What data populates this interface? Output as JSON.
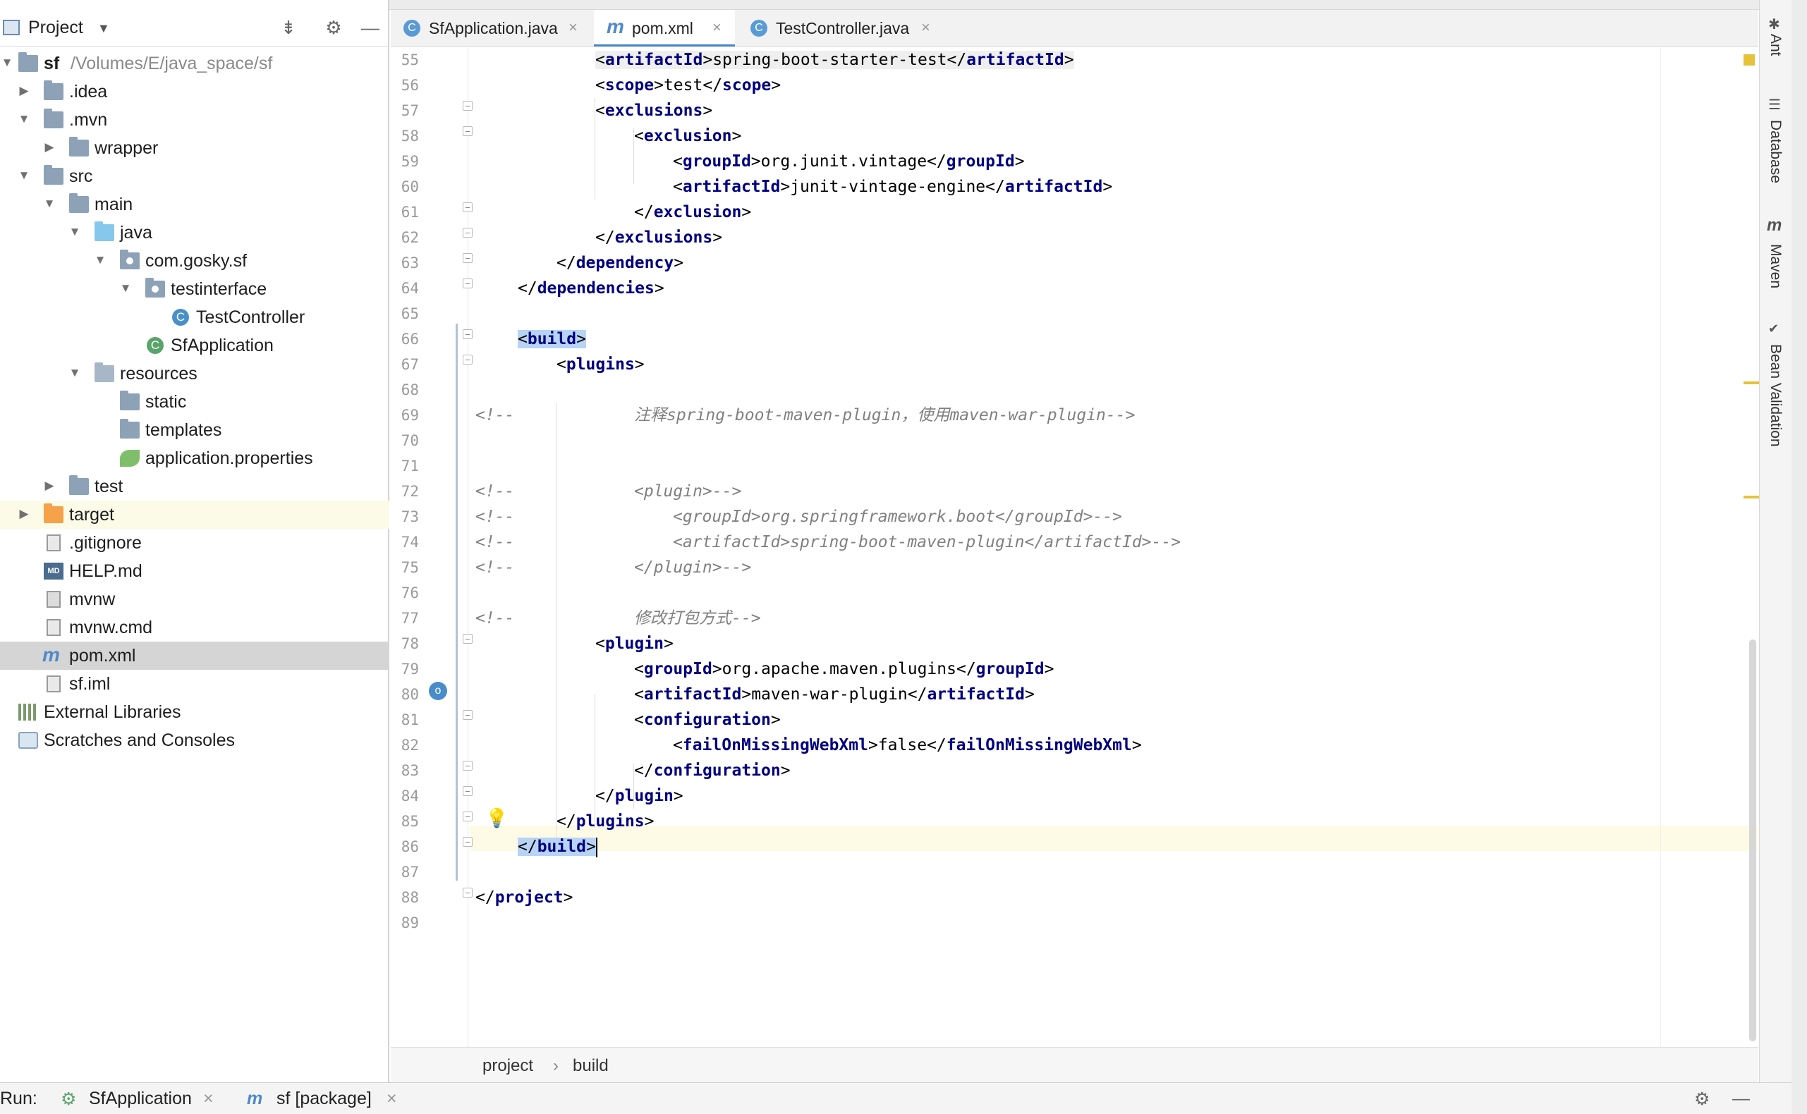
{
  "project_panel": {
    "title": "Project",
    "tree": [
      {
        "label": "sf",
        "path": "/Volumes/E/java_space/sf",
        "icon": "module-folder-icon"
      },
      {
        "label": ".idea",
        "icon": "folder-icon"
      },
      {
        "label": ".mvn",
        "icon": "folder-icon"
      },
      {
        "label": "wrapper",
        "icon": "folder-icon"
      },
      {
        "label": "src",
        "icon": "folder-icon"
      },
      {
        "label": "main",
        "icon": "folder-icon"
      },
      {
        "label": "java",
        "icon": "source-folder-icon"
      },
      {
        "label": "com.gosky.sf",
        "icon": "package-icon"
      },
      {
        "label": "testinterface",
        "icon": "package-icon"
      },
      {
        "label": "TestController",
        "icon": "class-icon"
      },
      {
        "label": "SfApplication",
        "icon": "spring-class-icon"
      },
      {
        "label": "resources",
        "icon": "resources-folder-icon"
      },
      {
        "label": "static",
        "icon": "folder-icon"
      },
      {
        "label": "templates",
        "icon": "folder-icon"
      },
      {
        "label": "application.properties",
        "icon": "spring-properties-icon"
      },
      {
        "label": "test",
        "icon": "folder-icon"
      },
      {
        "label": "target",
        "icon": "excluded-folder-icon"
      },
      {
        "label": ".gitignore",
        "icon": "file-icon"
      },
      {
        "label": "HELP.md",
        "icon": "markdown-icon"
      },
      {
        "label": "mvnw",
        "icon": "script-icon"
      },
      {
        "label": "mvnw.cmd",
        "icon": "file-icon"
      },
      {
        "label": "pom.xml",
        "icon": "maven-icon"
      },
      {
        "label": "sf.iml",
        "icon": "file-icon"
      },
      {
        "label": "External Libraries",
        "icon": "library-icon"
      },
      {
        "label": "Scratches and Consoles",
        "icon": "scratch-icon"
      }
    ]
  },
  "tabs": [
    {
      "label": "SfApplication.java",
      "icon": "class-icon"
    },
    {
      "label": "pom.xml",
      "icon": "maven-icon"
    },
    {
      "label": "TestController.java",
      "icon": "class-icon"
    }
  ],
  "editor": {
    "line_numbers": [
      "55",
      "56",
      "57",
      "58",
      "59",
      "60",
      "61",
      "62",
      "63",
      "64",
      "65",
      "66",
      "67",
      "68",
      "69",
      "70",
      "71",
      "72",
      "73",
      "74",
      "75",
      "76",
      "77",
      "78",
      "79",
      "80",
      "81",
      "82",
      "83",
      "84",
      "85",
      "86",
      "87",
      "88",
      "89"
    ],
    "code": {
      "l55": {
        "open": "<",
        "tag": "artifactId",
        "mid": ">spring-boot-starter-test</",
        "tag2": "artifactId",
        "close": ">"
      },
      "l56": {
        "open": "<",
        "tag": "scope",
        "mid": ">test</",
        "tag2": "scope",
        "close": ">"
      },
      "l57": {
        "open": "<",
        "tag": "exclusions",
        "close": ">"
      },
      "l58": {
        "open": "<",
        "tag": "exclusion",
        "close": ">"
      },
      "l59": {
        "open": "<",
        "tag": "groupId",
        "mid": ">org.junit.vintage</",
        "tag2": "groupId",
        "close": ">"
      },
      "l60": {
        "open": "<",
        "tag": "artifactId",
        "mid": ">junit-vintage-engine</",
        "tag2": "artifactId",
        "close": ">"
      },
      "l61": {
        "open": "</",
        "tag": "exclusion",
        "close": ">"
      },
      "l62": {
        "open": "</",
        "tag": "exclusions",
        "close": ">"
      },
      "l63": {
        "open": "</",
        "tag": "dependency",
        "close": ">"
      },
      "l64": {
        "open": "</",
        "tag": "dependencies",
        "close": ">"
      },
      "l66": {
        "open": "<",
        "tag": "build",
        "close": ">"
      },
      "l67": {
        "open": "<",
        "tag": "plugins",
        "close": ">"
      },
      "l69": {
        "prefix": "<!--",
        "text": "注释spring-boot-maven-plugin，使用maven-war-plugin-->"
      },
      "l72": {
        "prefix": "<!--",
        "text": "<plugin>-->"
      },
      "l73": {
        "prefix": "<!--",
        "text": "<groupId>org.springframework.boot</groupId>-->"
      },
      "l74": {
        "prefix": "<!--",
        "text": "<artifactId>spring-boot-maven-plugin</artifactId>-->"
      },
      "l75": {
        "prefix": "<!--",
        "text": "</plugin>-->"
      },
      "l77": {
        "prefix": "<!--",
        "text": "修改打包方式-->"
      },
      "l78": {
        "open": "<",
        "tag": "plugin",
        "close": ">"
      },
      "l79": {
        "open": "<",
        "tag": "groupId",
        "mid": ">org.apache.maven.plugins</",
        "tag2": "groupId",
        "close": ">"
      },
      "l80": {
        "open": "<",
        "tag": "artifactId",
        "mid": ">maven-war-plugin</",
        "tag2": "artifactId",
        "close": ">"
      },
      "l81": {
        "open": "<",
        "tag": "configuration",
        "close": ">"
      },
      "l82": {
        "open": "<",
        "tag": "failOnMissingWebXml",
        "mid": ">false</",
        "tag2": "failOnMissingWebXml",
        "close": ">"
      },
      "l83": {
        "open": "</",
        "tag": "configuration",
        "close": ">"
      },
      "l84": {
        "open": "</",
        "tag": "plugin",
        "close": ">"
      },
      "l85": {
        "open": "</",
        "tag": "plugins",
        "close": ">"
      },
      "l86": {
        "open": "</",
        "tag": "build",
        "close": ">"
      },
      "l88": {
        "open": "</",
        "tag": "project",
        "close": ">"
      }
    }
  },
  "breadcrumb": {
    "items": [
      "project",
      "build"
    ],
    "separator": "›"
  },
  "tool_strip": {
    "items": [
      "Ant",
      "Database",
      "Maven",
      "Bean Validation"
    ]
  },
  "run_bar": {
    "label": "Run:",
    "tabs": [
      "SfApplication",
      "sf [package]"
    ]
  },
  "colors": {
    "accent": "#4083c9",
    "xml_tag": "#000080",
    "comment": "#808080",
    "selection": "#d5d5d5",
    "build_highlight": "#b7d3f5"
  }
}
